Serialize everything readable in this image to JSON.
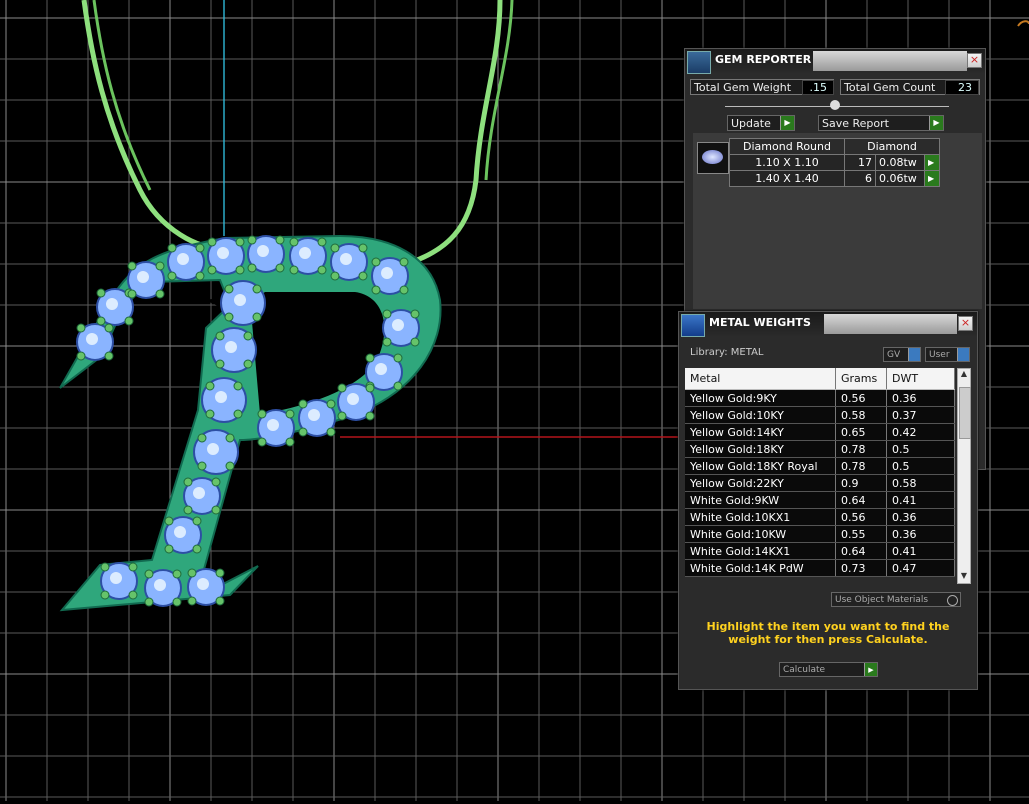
{
  "gem_reporter": {
    "title": "GEM REPORTER",
    "total_weight_label": "Total Gem Weight",
    "total_weight_value": ".15",
    "total_count_label": "Total Gem Count",
    "total_count_value": "23",
    "update_label": "Update",
    "save_report_label": "Save Report",
    "close_glyph": "×",
    "table": {
      "headers": [
        "Diamond Round",
        "Diamond"
      ],
      "rows": [
        {
          "size": "1.10 X 1.10",
          "count": "17",
          "weight": "0.08tw"
        },
        {
          "size": "1.40 X 1.40",
          "count": "6",
          "weight": "0.06tw"
        }
      ]
    }
  },
  "metal_weights": {
    "title": "METAL WEIGHTS",
    "library": "Library: METAL",
    "gv_label": "GV",
    "user_label": "User",
    "columns": [
      "Metal",
      "Grams",
      "DWT"
    ],
    "rows": [
      {
        "metal": "Yellow Gold:9KY",
        "grams": "0.56",
        "dwt": "0.36"
      },
      {
        "metal": "Yellow Gold:10KY",
        "grams": "0.58",
        "dwt": "0.37"
      },
      {
        "metal": "Yellow Gold:14KY",
        "grams": "0.65",
        "dwt": "0.42"
      },
      {
        "metal": "Yellow Gold:18KY",
        "grams": "0.78",
        "dwt": "0.5"
      },
      {
        "metal": "Yellow Gold:18KY Royal",
        "grams": "0.78",
        "dwt": "0.5"
      },
      {
        "metal": "Yellow Gold:22KY",
        "grams": "0.9",
        "dwt": "0.58"
      },
      {
        "metal": "White Gold:9KW",
        "grams": "0.64",
        "dwt": "0.41"
      },
      {
        "metal": "White Gold:10KX1",
        "grams": "0.56",
        "dwt": "0.36"
      },
      {
        "metal": "White Gold:10KW",
        "grams": "0.55",
        "dwt": "0.36"
      },
      {
        "metal": "White Gold:14KX1",
        "grams": "0.64",
        "dwt": "0.41"
      },
      {
        "metal": "White Gold:14K PdW",
        "grams": "0.73",
        "dwt": "0.47"
      }
    ],
    "use_object_materials_label": "Use Object Materials",
    "instruction": "Highlight the item you want to find the weight for then press Calculate.",
    "calculate_label": "Calculate",
    "close_glyph": "×"
  },
  "colors": {
    "model_green": "#2fa77c",
    "chain_green": "#8ee07e",
    "gem_blue": "#8ab4ff",
    "axis_red": "#b3141a",
    "instruction_yellow": "#ffd21f"
  },
  "icons": [
    "gem-reporter-icon",
    "close-icon",
    "gem-icon",
    "metal-weights-icon",
    "scroll-up-icon",
    "scroll-down-icon"
  ]
}
